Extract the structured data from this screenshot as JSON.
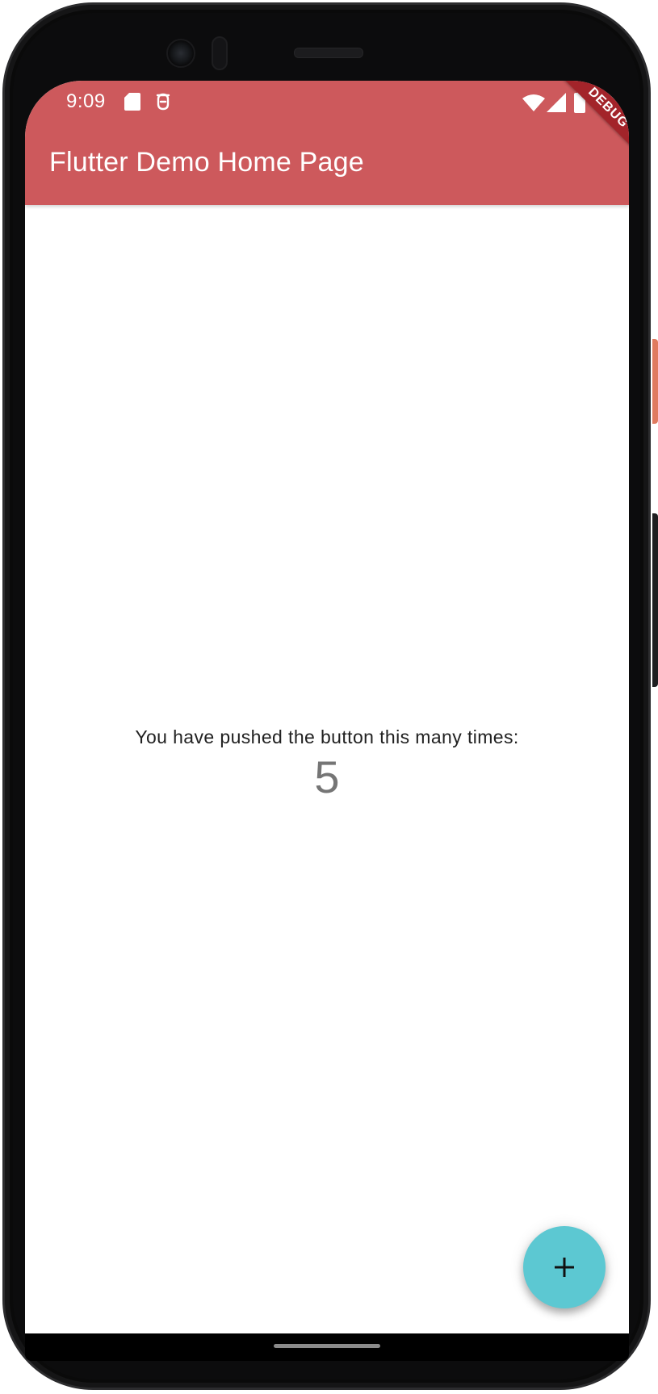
{
  "status_bar": {
    "time": "9:09",
    "icons": [
      "sd-card-icon",
      "debug-bug-icon",
      "wifi-icon",
      "signal-icon",
      "battery-icon"
    ]
  },
  "app_bar": {
    "title": "Flutter Demo Home Page",
    "color": "#cd595c"
  },
  "debug_banner": {
    "label": "DEBUG",
    "color": "#a3242a"
  },
  "body": {
    "counter_label": "You have pushed the button this many times:",
    "counter_value": "5"
  },
  "fab": {
    "icon": "plus-icon",
    "color": "#5cc8d2"
  }
}
